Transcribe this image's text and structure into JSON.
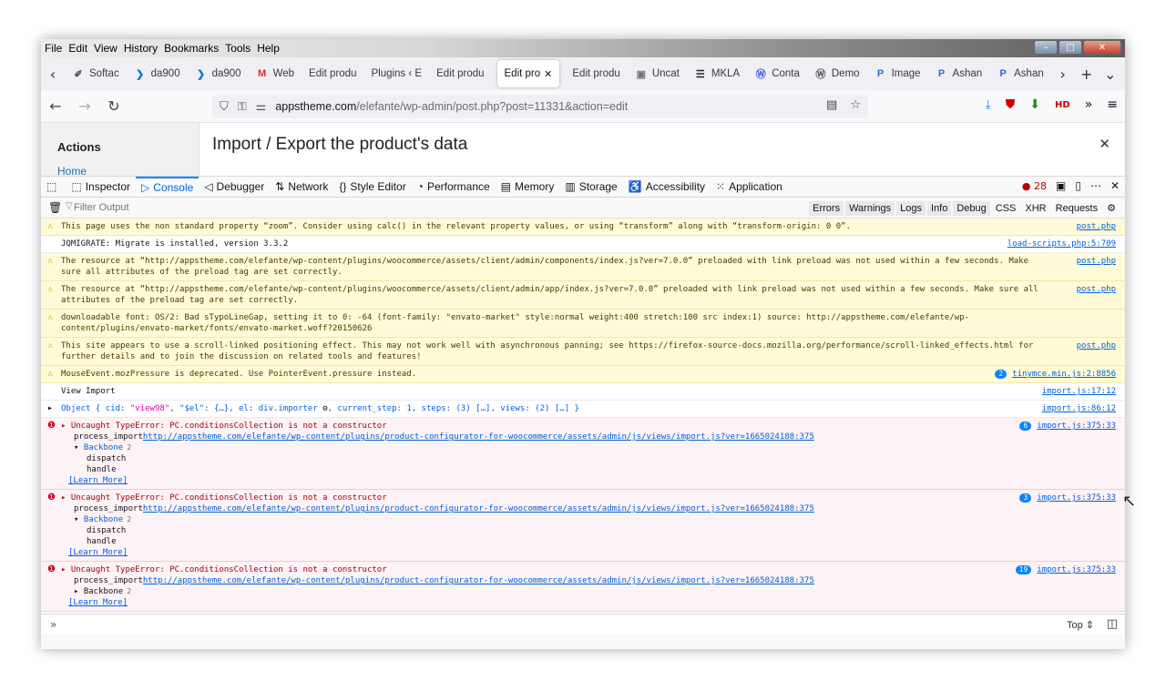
{
  "menubar": {
    "items": [
      "File",
      "Edit",
      "View",
      "History",
      "Bookmarks",
      "Tools",
      "Help"
    ],
    "controls": [
      "–",
      "□",
      "✕"
    ]
  },
  "tabs": [
    {
      "label": "Softac",
      "icon": "feather-icon",
      "glyph": "✐",
      "color": "#555"
    },
    {
      "label": "da900",
      "icon": "chevron-icon",
      "glyph": "❯",
      "color": "#0b7cd3"
    },
    {
      "label": "da900",
      "icon": "chevron-icon",
      "glyph": "❯",
      "color": "#0b7cd3"
    },
    {
      "label": "Web",
      "icon": "gmail-icon",
      "glyph": "M",
      "color": "#d93025"
    },
    {
      "label": "Edit produ",
      "icon": "",
      "glyph": "",
      "color": ""
    },
    {
      "label": "Plugins ‹ E",
      "icon": "",
      "glyph": "",
      "color": ""
    },
    {
      "label": "Edit produ",
      "icon": "",
      "glyph": "",
      "color": ""
    },
    {
      "label": "Edit pro",
      "icon": "",
      "glyph": "",
      "color": "",
      "active": true
    },
    {
      "label": "Edit produ",
      "icon": "",
      "glyph": "",
      "color": ""
    },
    {
      "label": "Uncat",
      "icon": "page-icon",
      "glyph": "▣",
      "color": "#777"
    },
    {
      "label": "MKLA",
      "icon": "list-icon",
      "glyph": "☰",
      "color": "#222"
    },
    {
      "label": "Conta",
      "icon": "wordpress-icon",
      "glyph": "Ⓦ",
      "color": "#3858e9"
    },
    {
      "label": "Demo",
      "icon": "wordpress-icon",
      "glyph": "Ⓦ",
      "color": "#555"
    },
    {
      "label": "Image",
      "icon": "p-icon",
      "glyph": "P",
      "color": "#2d6bd8"
    },
    {
      "label": "Ashan",
      "icon": "p-icon",
      "glyph": "P",
      "color": "#2d6bd8"
    },
    {
      "label": "Ashan",
      "icon": "p-icon",
      "glyph": "P",
      "color": "#2d6bd8"
    }
  ],
  "url": {
    "host": "appstheme.com",
    "path": "/elefante/wp-admin/post.php?post=11331&action=edit"
  },
  "page": {
    "sidebar_title": "Actions",
    "sidebar_home": "Home",
    "title": "Import / Export the product's data",
    "close": "✕"
  },
  "devtools": {
    "tabs": [
      {
        "label": "Inspector",
        "icon": "inspector-icon",
        "glyph": "⬚"
      },
      {
        "label": "Console",
        "icon": "console-icon",
        "glyph": "▷",
        "active": true
      },
      {
        "label": "Debugger",
        "icon": "debugger-icon",
        "glyph": "◁"
      },
      {
        "label": "Network",
        "icon": "network-icon",
        "glyph": "⇅"
      },
      {
        "label": "Style Editor",
        "icon": "style-editor-icon",
        "glyph": "{}"
      },
      {
        "label": "Performance",
        "icon": "performance-icon",
        "glyph": "◔"
      },
      {
        "label": "Memory",
        "icon": "memory-icon",
        "glyph": "▤"
      },
      {
        "label": "Storage",
        "icon": "storage-icon",
        "glyph": "▥"
      },
      {
        "label": "Accessibility",
        "icon": "accessibility-icon",
        "glyph": "♿"
      },
      {
        "label": "Application",
        "icon": "application-icon",
        "glyph": "⁙"
      }
    ],
    "error_count": "28",
    "filter_placeholder": "Filter Output",
    "filter_buttons": [
      "Errors",
      "Warnings",
      "Logs",
      "Info",
      "Debug"
    ],
    "extra_filters": [
      "CSS",
      "XHR",
      "Requests"
    ],
    "context": "Top"
  },
  "console": [
    {
      "level": "warn",
      "text": "This page uses the non standard property “zoom”. Consider using calc() in the relevant property values, or using “transform” along with “transform-origin: 0 0”.",
      "source": "post.php"
    },
    {
      "level": "log",
      "text": "JQMIGRATE: Migrate is installed, version 3.3.2",
      "source": "load-scripts.php:5:709"
    },
    {
      "level": "warn",
      "text": "The resource at “http://appstheme.com/elefante/wp-content/plugins/woocommerce/assets/client/admin/components/index.js?ver=7.0.0” preloaded with link preload was not used within a few seconds. Make sure all attributes of the preload tag are set correctly.",
      "source": "post.php"
    },
    {
      "level": "warn",
      "text": "The resource at “http://appstheme.com/elefante/wp-content/plugins/woocommerce/assets/client/admin/app/index.js?ver=7.0.0” preloaded with link preload was not used within a few seconds. Make sure all attributes of the preload tag are set correctly.",
      "source": "post.php"
    },
    {
      "level": "warn",
      "text": "downloadable font: OS/2: Bad sTypoLineGap, setting it to 0: -64 (font-family: \"envato-market\" style:normal weight:400 stretch:100 src index:1) source: http://appstheme.com/elefante/wp-content/plugins/envato-market/fonts/envato-market.woff?20150626",
      "source": ""
    },
    {
      "level": "warn",
      "text": "This site appears to use a scroll-linked positioning effect. This may not work well with asynchronous panning; see https://firefox-source-docs.mozilla.org/performance/scroll-linked_effects.html for further details and to join the discussion on related tools and features!",
      "source": "post.php"
    },
    {
      "level": "warn",
      "text": "MouseEvent.mozPressure is deprecated. Use PointerEvent.pressure instead.",
      "source": "tinymce.min.js:2:8856",
      "repeat": "2"
    },
    {
      "level": "log",
      "text": "View Import",
      "source": "import.js:17:12"
    }
  ],
  "object_log": {
    "prefix": "Object { cid: ",
    "cid": "\"view98\"",
    "mid": ", \"$el\": {…}, el: div.importer ",
    "tail1": ", current_step: ",
    "step": "1",
    "tail2": ", steps: (3) […], views: (2) […] }",
    "source": "import.js:86:12"
  },
  "errors": [
    {
      "message": "Uncaught TypeError: PC.conditionsCollection is not a constructor",
      "fn": "process_import",
      "url": "http://appstheme.com/elefante/wp-content/plugins/product-configurator-for-woocommerce/assets/admin/js/views/import.js?ver=1665024188:375",
      "group": "Backbone",
      "group_count": "2",
      "expanded": true,
      "frames": [
        "dispatch",
        "handle"
      ],
      "learn": "[Learn More]",
      "source": "import.js:375:33",
      "repeat": "6"
    },
    {
      "message": "Uncaught TypeError: PC.conditionsCollection is not a constructor",
      "fn": "process_import",
      "url": "http://appstheme.com/elefante/wp-content/plugins/product-configurator-for-woocommerce/assets/admin/js/views/import.js?ver=1665024188:375",
      "group": "Backbone",
      "group_count": "2",
      "expanded": true,
      "frames": [
        "dispatch",
        "handle"
      ],
      "learn": "[Learn More]",
      "source": "import.js:375:33",
      "repeat": "3"
    },
    {
      "message": "Uncaught TypeError: PC.conditionsCollection is not a constructor",
      "fn": "process_import",
      "url": "http://appstheme.com/elefante/wp-content/plugins/product-configurator-for-woocommerce/assets/admin/js/views/import.js?ver=1665024188:375",
      "group": "Backbone",
      "group_count": "2",
      "expanded": false,
      "frames": [],
      "learn": "[Learn More]",
      "source": "import.js:375:33",
      "repeat": "19"
    }
  ]
}
